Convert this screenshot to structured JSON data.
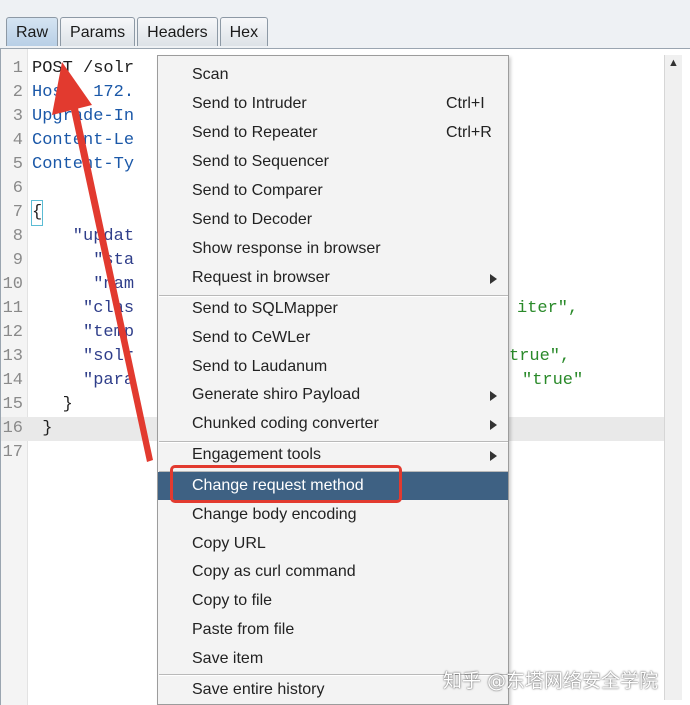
{
  "tabs": [
    {
      "label": "Raw",
      "active": true
    },
    {
      "label": "Params",
      "active": false
    },
    {
      "label": "Headers",
      "active": false
    },
    {
      "label": "Hex",
      "active": false
    }
  ],
  "editor": {
    "lines": [
      {
        "n": "1",
        "text": "POST /solr"
      },
      {
        "n": "2",
        "text": "Host: 172."
      },
      {
        "n": "3",
        "text": "Upgrade-In"
      },
      {
        "n": "4",
        "text": "Content-Le"
      },
      {
        "n": "5",
        "text": "Content-Ty"
      },
      {
        "n": "6",
        "text": ""
      },
      {
        "n": "7",
        "text": "{"
      },
      {
        "n": "8",
        "text": "    \"updat"
      },
      {
        "n": "9",
        "text": "      \"sta"
      },
      {
        "n": "10",
        "text": "      \"nam"
      },
      {
        "n": "11",
        "text": "     \"clas",
        "tail": "iter\","
      },
      {
        "n": "12",
        "text": "     \"temp"
      },
      {
        "n": "13",
        "text": "     \"solr",
        "tail": "true\","
      },
      {
        "n": "14",
        "text": "     \"para",
        "tail": "\"true\""
      },
      {
        "n": "15",
        "text": "   }"
      },
      {
        "n": "16",
        "text": " }"
      },
      {
        "n": "17",
        "text": ""
      }
    ]
  },
  "menu": {
    "scan": "Scan",
    "intruder": "Send to Intruder",
    "intruder_sc": "Ctrl+I",
    "repeater": "Send to Repeater",
    "repeater_sc": "Ctrl+R",
    "sequencer": "Send to Sequencer",
    "comparer": "Send to Comparer",
    "decoder": "Send to Decoder",
    "show_response": "Show response in browser",
    "request_browser": "Request in browser",
    "sqlmapper": "Send to SQLMapper",
    "cewler": "Send to CeWLer",
    "laudanum": "Send to Laudanum",
    "shiro": "Generate shiro Payload",
    "chunked": "Chunked coding converter",
    "engagement": "Engagement tools",
    "change_method": "Change request method",
    "change_encoding": "Change body encoding",
    "copy_url": "Copy URL",
    "copy_curl": "Copy as curl command",
    "copy_file": "Copy to file",
    "paste_file": "Paste from file",
    "save_item": "Save item",
    "save_history": "Save entire history"
  },
  "watermark": "知乎 @东塔网络安全学院",
  "colors": {
    "selected": "#3e6183",
    "highlight_box": "#e23a2f",
    "annotation_arrow": "#e23a2f"
  }
}
